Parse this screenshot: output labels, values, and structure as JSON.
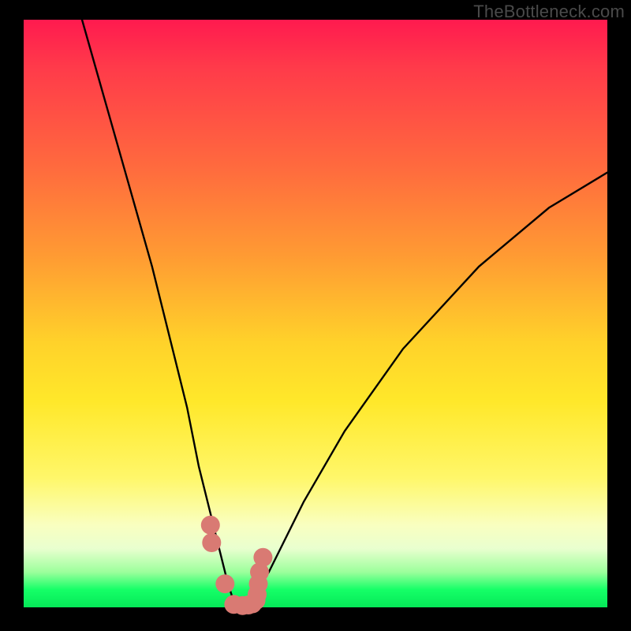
{
  "watermark": "TheBottleneck.com",
  "colors": {
    "frame_bg": "#000000",
    "marker": "#d97a73",
    "curve": "#000000",
    "gradient_top": "#ff1a4f",
    "gradient_bottom": "#05e858"
  },
  "chart_data": {
    "type": "line",
    "title": "",
    "xlabel": "",
    "ylabel": "",
    "xlim": [
      0,
      100
    ],
    "ylim": [
      0,
      100
    ],
    "series": [
      {
        "name": "bottleneck-curve",
        "x": [
          10,
          14,
          18,
          22,
          26,
          28,
          30,
          32,
          34,
          35,
          36,
          37,
          38,
          39,
          40,
          42,
          44,
          48,
          55,
          65,
          78,
          90,
          100
        ],
        "y": [
          100,
          86,
          72,
          58,
          42,
          34,
          24,
          16,
          8,
          4,
          1,
          0,
          0,
          1,
          3,
          6,
          10,
          18,
          30,
          44,
          58,
          68,
          74
        ]
      }
    ],
    "markers": {
      "name": "highlight-points",
      "x": [
        32.0,
        32.2,
        34.5,
        36.0,
        37.5,
        38.5,
        39.2,
        39.8,
        40.0,
        40.2,
        40.4,
        41.0
      ],
      "y": [
        14.0,
        11.0,
        4.0,
        0.5,
        0.3,
        0.4,
        0.6,
        1.2,
        2.2,
        4.0,
        6.0,
        8.5
      ]
    }
  }
}
